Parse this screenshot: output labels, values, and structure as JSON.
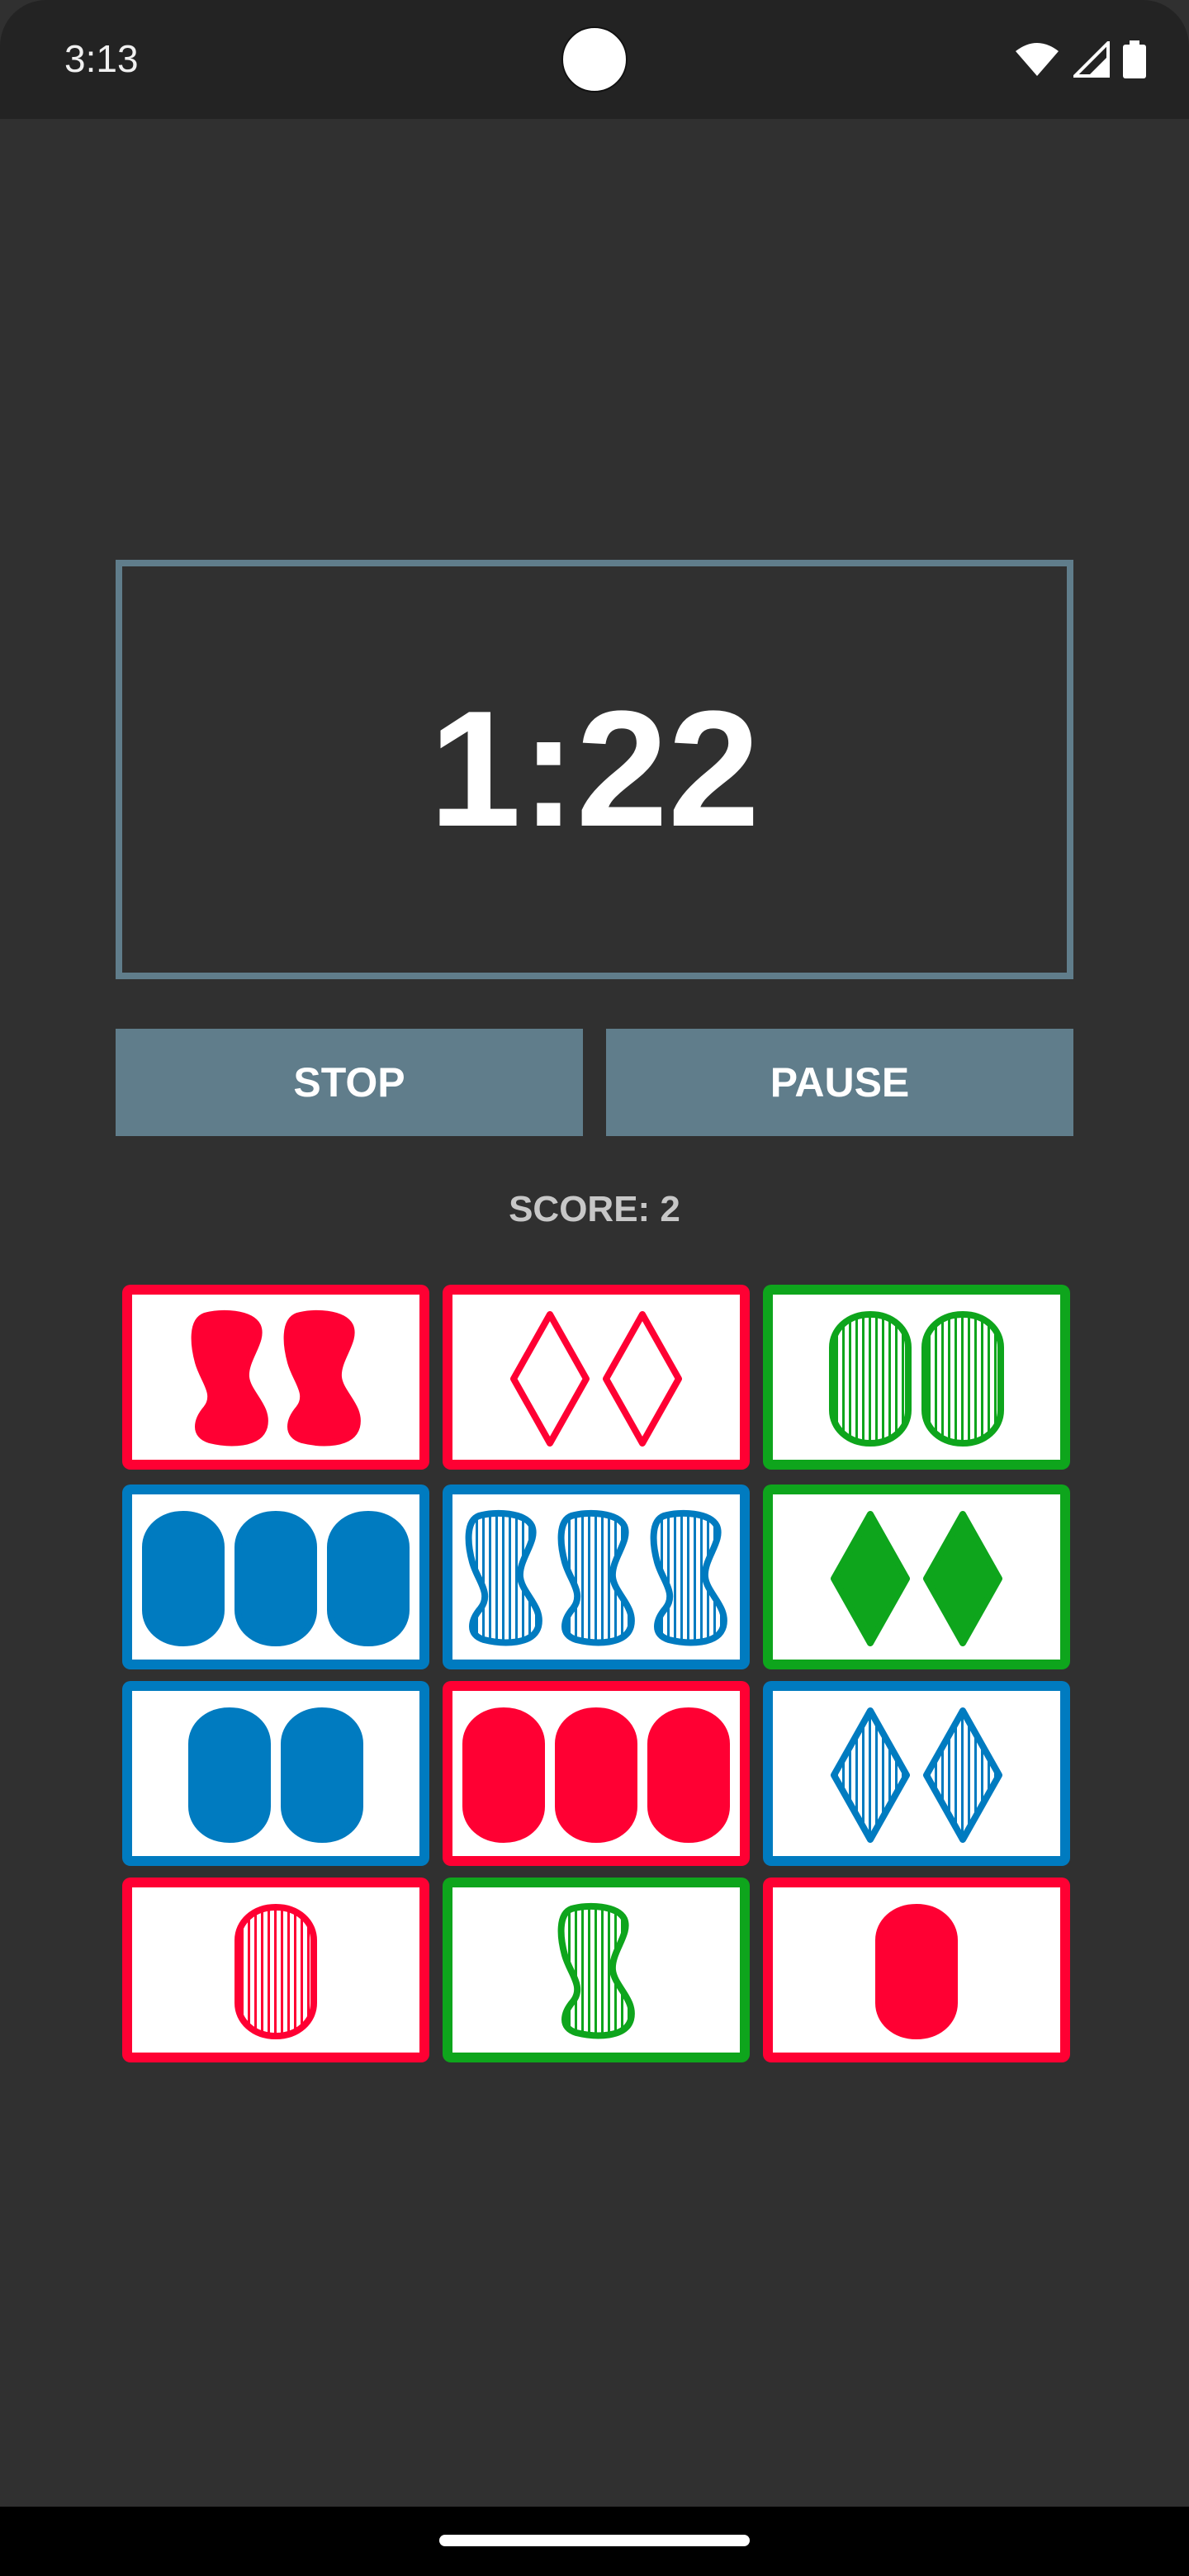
{
  "status_bar": {
    "time": "3:13",
    "icons": [
      "wifi-icon",
      "signal-icon",
      "battery-icon"
    ]
  },
  "timer": {
    "value": "1:22"
  },
  "buttons": {
    "stop_label": "STOP",
    "pause_label": "PAUSE"
  },
  "score": {
    "label": "SCORE: 2"
  },
  "colors": {
    "red": "#ff0033",
    "green": "#0ea51c",
    "blue": "#007bc0",
    "accent": "#607d8b",
    "background": "#303030"
  },
  "cards": [
    {
      "color": "red",
      "count": 2,
      "shape": "squiggle",
      "shading": "solid"
    },
    {
      "color": "red",
      "count": 2,
      "shape": "diamond",
      "shading": "open"
    },
    {
      "color": "green",
      "count": 2,
      "shape": "oval",
      "shading": "striped"
    },
    {
      "color": "blue",
      "count": 3,
      "shape": "oval",
      "shading": "solid"
    },
    {
      "color": "blue",
      "count": 3,
      "shape": "squiggle",
      "shading": "striped"
    },
    {
      "color": "green",
      "count": 2,
      "shape": "diamond",
      "shading": "solid"
    },
    {
      "color": "blue",
      "count": 2,
      "shape": "oval",
      "shading": "solid"
    },
    {
      "color": "red",
      "count": 3,
      "shape": "oval",
      "shading": "solid"
    },
    {
      "color": "blue",
      "count": 2,
      "shape": "diamond",
      "shading": "striped"
    },
    {
      "color": "red",
      "count": 1,
      "shape": "oval",
      "shading": "striped"
    },
    {
      "color": "green",
      "count": 1,
      "shape": "squiggle",
      "shading": "striped"
    },
    {
      "color": "red",
      "count": 1,
      "shape": "oval",
      "shading": "solid"
    }
  ]
}
